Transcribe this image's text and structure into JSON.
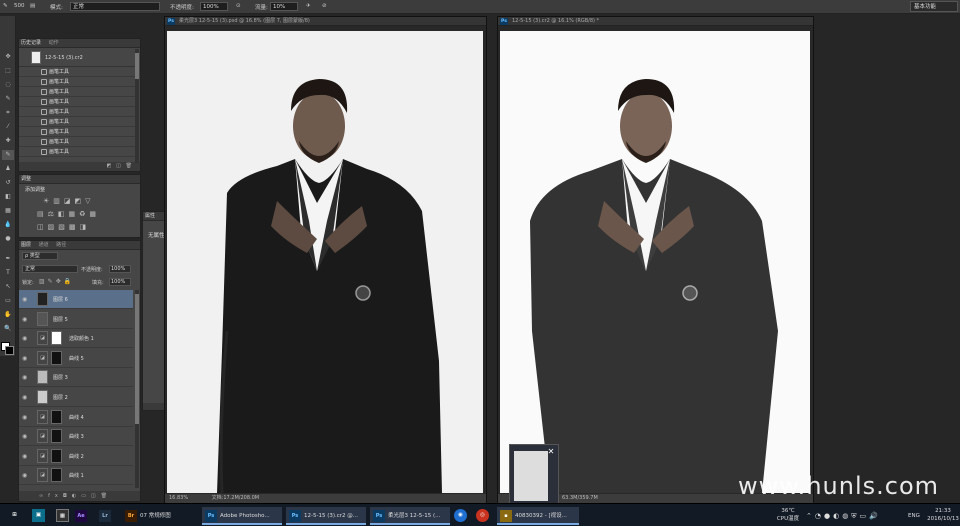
{
  "options_bar": {
    "brush_size": "500",
    "mode_label": "模式:",
    "mode_value": "正常",
    "opacity_label": "不透明度:",
    "opacity_value": "100%",
    "flow_label": "流量:",
    "flow_value": "10%",
    "workspace": "基本功能"
  },
  "history_panel": {
    "tabs": [
      "历史记录",
      "动作"
    ],
    "snapshot": "12-5-15 (3).cr2",
    "items": [
      "画笔工具",
      "画笔工具",
      "画笔工具",
      "画笔工具",
      "画笔工具",
      "画笔工具",
      "画笔工具",
      "画笔工具",
      "画笔工具"
    ]
  },
  "adjustments_panel": {
    "tab": "调整",
    "title": "添加调整"
  },
  "properties_panel": {
    "tab": "属性",
    "text": "无属性"
  },
  "layers_panel": {
    "tabs": [
      "图层",
      "通道",
      "路径"
    ],
    "filter": "类型",
    "blend_mode": "正常",
    "opacity_label": "不透明度:",
    "opacity_value": "100%",
    "lock_label": "锁定:",
    "fill_label": "填充:",
    "fill_value": "100%",
    "layers": [
      {
        "name": "图层 6",
        "selected": true
      },
      {
        "name": "图层 5",
        "selected": false
      },
      {
        "name": "选取颜色 1",
        "selected": false
      },
      {
        "name": "曲线 5",
        "selected": false
      },
      {
        "name": "图层 3",
        "selected": false
      },
      {
        "name": "图层 2",
        "selected": false
      },
      {
        "name": "曲线 4",
        "selected": false
      },
      {
        "name": "曲线 3",
        "selected": false
      },
      {
        "name": "曲线 2",
        "selected": false
      },
      {
        "name": "曲线 1",
        "selected": false
      }
    ]
  },
  "doc_left": {
    "tab": "柔光层3 12-5-15 (3).psd @ 16.8% (图层 7, 图层蒙版/8)",
    "zoom": "16.83%",
    "doc_info": "文档:17.2M/208.0M"
  },
  "doc_right": {
    "tab": "12-5-15 (3).cr2 @ 16.1% (RGB/8) *",
    "doc_info": "63.3M/359.7M"
  },
  "watermark": "www.hunls.com",
  "taskbar": {
    "items": [
      {
        "icon": "Ae",
        "label": ""
      },
      {
        "icon": "Lr",
        "label": ""
      },
      {
        "icon": "Br",
        "label": "07 常规修图"
      },
      {
        "icon": "Ps",
        "label": "Adobe Photosho..."
      },
      {
        "icon": "Ps",
        "label": "12-5-15 (3).cr2 @..."
      },
      {
        "icon": "Ps",
        "label": "柔光层3 12-5-15 (..."
      },
      {
        "icon": "",
        "label": "40830392 - [视设..."
      }
    ],
    "temp": "36℃",
    "temp_label": "CPU温度",
    "lang": "ENG",
    "time": "21:33",
    "date": "2016/10/13"
  }
}
